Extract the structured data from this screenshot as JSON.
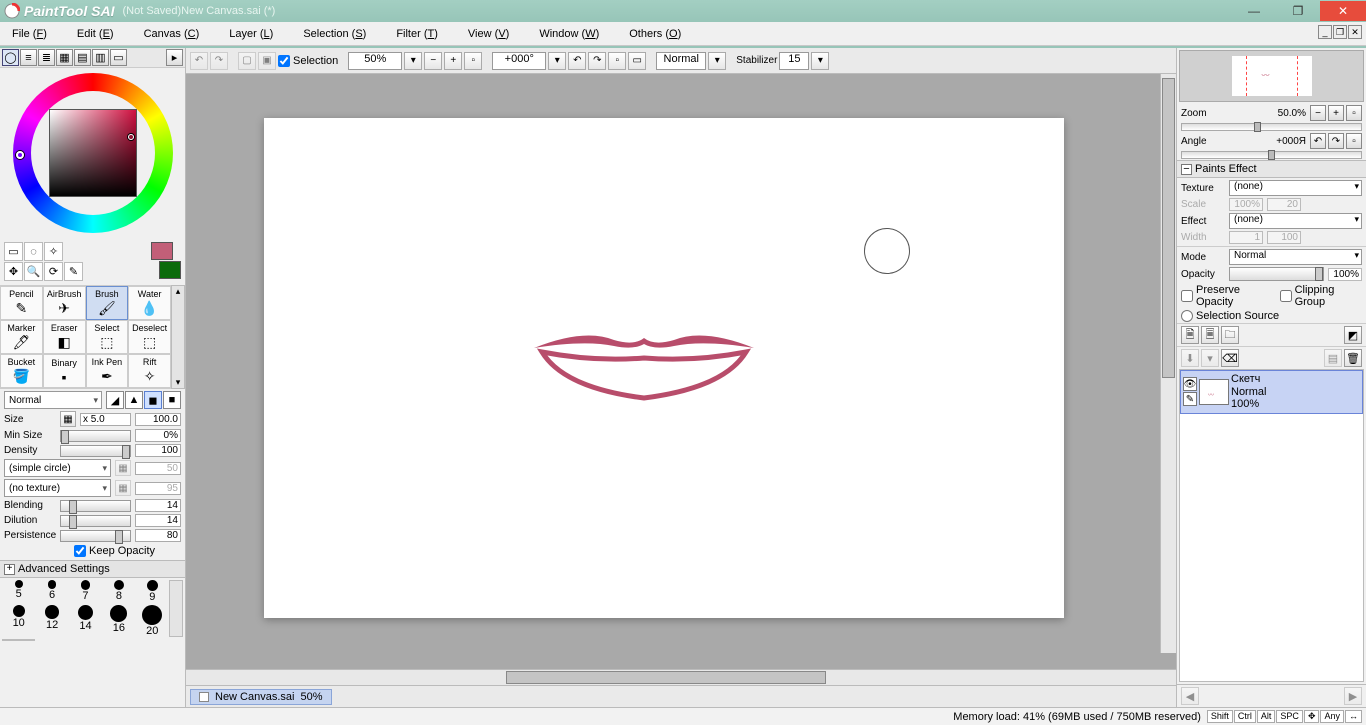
{
  "app": {
    "name_italic": "PaintTool SAI",
    "doc_title": "(Not Saved)New Canvas.sai (*)"
  },
  "win_buttons": {
    "min": "—",
    "max": "❐",
    "close": "✕"
  },
  "menu": [
    {
      "label": "File",
      "u": "F"
    },
    {
      "label": "Edit",
      "u": "E"
    },
    {
      "label": "Canvas",
      "u": "C"
    },
    {
      "label": "Layer",
      "u": "L"
    },
    {
      "label": "Selection",
      "u": "S"
    },
    {
      "label": "Filter",
      "u": "T"
    },
    {
      "label": "View",
      "u": "V"
    },
    {
      "label": "Window",
      "u": "W"
    },
    {
      "label": "Others",
      "u": "O"
    }
  ],
  "top_toolbar": {
    "selection_label": "Selection",
    "zoom": "50%",
    "angle": "+000°",
    "mode": "Normal",
    "stabilizer_label": "Stabilizer",
    "stabilizer_val": "15"
  },
  "colors": {
    "fg": "#c25f78",
    "bg": "#0a6b0a"
  },
  "brush_tools": [
    "Pencil",
    "AirBrush",
    "Brush",
    "Water",
    "Marker",
    "Eraser",
    "Select",
    "Deselect",
    "Bucket",
    "Binary",
    "Ink Pen",
    "Rift"
  ],
  "brush_selected": 2,
  "brush_props": {
    "mode": "Normal",
    "size_mult": "x 5.0",
    "size_label": "Size",
    "size_val": "100.0",
    "minsize_label": "Min Size",
    "minsize_val": "0%",
    "density_label": "Density",
    "density_val": "100",
    "shape": "(simple circle)",
    "shape_val": "50",
    "texture": "(no texture)",
    "texture_val": "95",
    "blend_label": "Blending",
    "blend_val": "14",
    "dil_label": "Dilution",
    "dil_val": "14",
    "pers_label": "Persistence",
    "pers_val": "80",
    "keep_opacity": "Keep Opacity",
    "advanced": "Advanced Settings"
  },
  "brush_sizes_row1": [
    5,
    6,
    7,
    8,
    9
  ],
  "brush_sizes_row2": [
    10,
    12,
    14,
    16,
    20
  ],
  "center": {
    "doc_tab_name": "New Canvas.sai",
    "doc_tab_zoom": "50%"
  },
  "right": {
    "zoom_label": "Zoom",
    "zoom_val": "50.0%",
    "angle_label": "Angle",
    "angle_val": "+000Я",
    "paints_effect": "Paints Effect",
    "texture_label": "Texture",
    "texture_val": "(none)",
    "scale_label": "Scale",
    "scale_val": "100%",
    "scale_w": "20",
    "effect_label": "Effect",
    "effect_val": "(none)",
    "width_label": "Width",
    "width_n": "1",
    "width_v": "100",
    "mode_label": "Mode",
    "mode_val": "Normal",
    "opacity_label": "Opacity",
    "opacity_val": "100%",
    "preserve": "Preserve Opacity",
    "clipping": "Clipping Group",
    "selsrc": "Selection Source"
  },
  "layer": {
    "name": "Скетч",
    "mode": "Normal",
    "opacity": "100%"
  },
  "status": {
    "mem": "Memory load: 41% (69MB used / 750MB reserved)",
    "keys": [
      "Shift",
      "Ctrl",
      "Alt",
      "SPC",
      "✥",
      "Any",
      "↔"
    ]
  }
}
